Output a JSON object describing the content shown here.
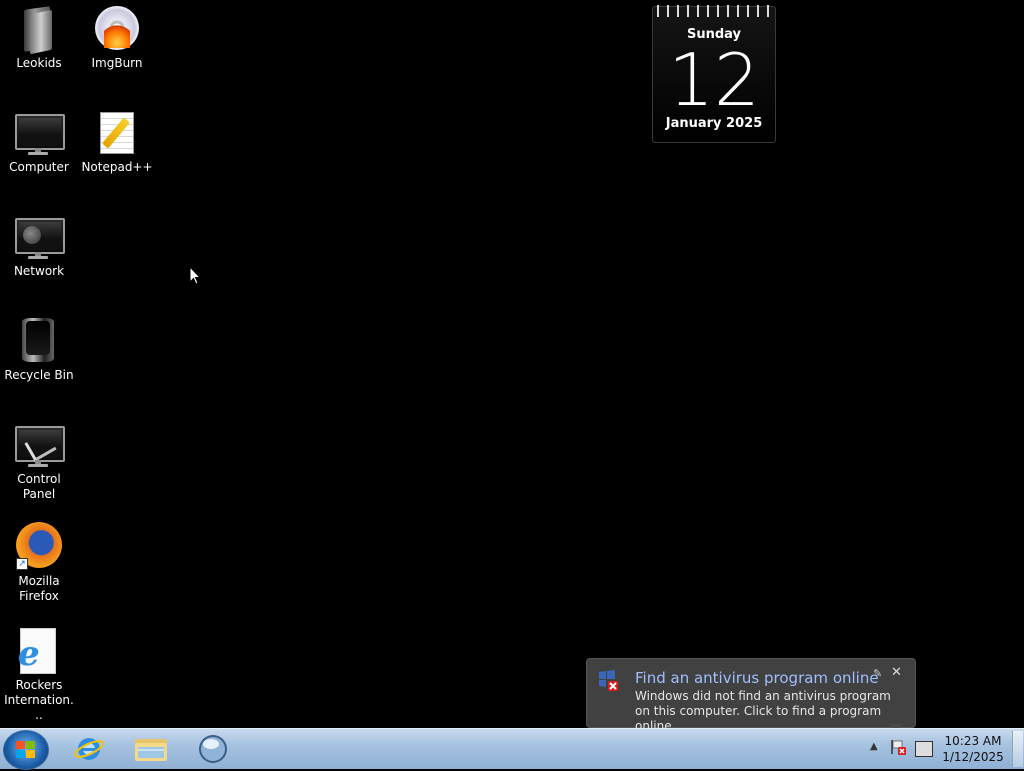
{
  "desktop": {
    "icons": [
      {
        "label": "Leokids"
      },
      {
        "label": "ImgBurn"
      },
      {
        "label": "Computer"
      },
      {
        "label": "Notepad++"
      },
      {
        "label": "Network"
      },
      {
        "label": "Recycle Bin"
      },
      {
        "label": "Control Panel"
      },
      {
        "label": "Mozilla Firefox"
      },
      {
        "label": "Rockers Internation..."
      }
    ]
  },
  "calendar": {
    "day_name": "Sunday",
    "day_number": "12",
    "month_year": "January 2025"
  },
  "notification": {
    "title": "Find an antivirus program online",
    "text": "Windows did not find an antivirus program on this computer. Click to find a program online.",
    "icon": "security-warning-icon"
  },
  "taskbar": {
    "pinned": [
      {
        "name": "internet-explorer-icon"
      },
      {
        "name": "windows-explorer-icon"
      },
      {
        "name": "windows-media-player-icon"
      }
    ],
    "clock": {
      "time": "10:23 AM",
      "date": "1/12/2025"
    }
  },
  "colors": {
    "desktop_background": "#000000",
    "taskbar": "#a6c2e0",
    "balloon_title": "#9fbfff"
  }
}
